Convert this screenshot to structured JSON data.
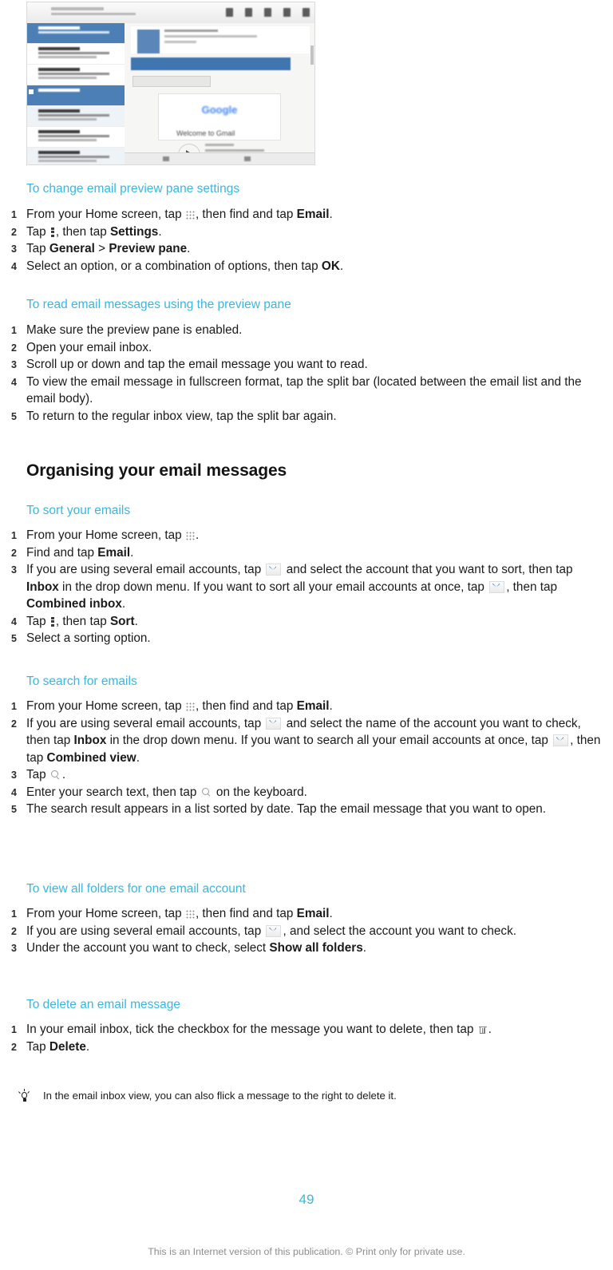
{
  "figure": {
    "caption": "Screenshot of tablet email application showing message list, preview pane and Welcome to Gmail message",
    "toolbar_icons": [
      "reply-icon",
      "refresh-icon",
      "search-icon",
      "delete-icon",
      "overflow-menu-icon"
    ],
    "welcome_title": "Welcome to Gmail",
    "brand": "Google"
  },
  "sections": [
    {
      "heading": "To change email preview pane settings",
      "steps": [
        {
          "num": "1",
          "parts": [
            {
              "type": "text",
              "text": "From your Home screen, tap "
            },
            {
              "type": "icon",
              "icon": "apps-grid-icon"
            },
            {
              "type": "text",
              "text": ", then find and tap "
            },
            {
              "type": "bold",
              "text": "Email"
            },
            {
              "type": "text",
              "text": "."
            }
          ]
        },
        {
          "num": "2",
          "parts": [
            {
              "type": "text",
              "text": "Tap "
            },
            {
              "type": "icon",
              "icon": "overflow-menu-icon"
            },
            {
              "type": "text",
              "text": ", then tap "
            },
            {
              "type": "bold",
              "text": "Settings"
            },
            {
              "type": "text",
              "text": "."
            }
          ]
        },
        {
          "num": "3",
          "parts": [
            {
              "type": "text",
              "text": "Tap "
            },
            {
              "type": "bold",
              "text": "General"
            },
            {
              "type": "text",
              "text": " > "
            },
            {
              "type": "bold",
              "text": "Preview pane"
            },
            {
              "type": "text",
              "text": "."
            }
          ]
        },
        {
          "num": "4",
          "parts": [
            {
              "type": "text",
              "text": "Select an option, or a combination of options, then tap "
            },
            {
              "type": "bold",
              "text": "OK"
            },
            {
              "type": "text",
              "text": "."
            }
          ]
        }
      ]
    },
    {
      "heading": "To read email messages using the preview pane",
      "steps": [
        {
          "num": "1",
          "parts": [
            {
              "type": "text",
              "text": "Make sure the preview pane is enabled."
            }
          ]
        },
        {
          "num": "2",
          "parts": [
            {
              "type": "text",
              "text": "Open your email inbox."
            }
          ]
        },
        {
          "num": "3",
          "parts": [
            {
              "type": "text",
              "text": "Scroll up or down and tap the email message you want to read."
            }
          ]
        },
        {
          "num": "4",
          "parts": [
            {
              "type": "text",
              "text": "To view the email message in fullscreen format, tap the split bar (located between the email list and the email body)."
            }
          ]
        },
        {
          "num": "5",
          "parts": [
            {
              "type": "text",
              "text": "To return to the regular inbox view, tap the split bar again."
            }
          ]
        }
      ]
    }
  ],
  "chapter_heading": "Organising your email messages",
  "sections2": [
    {
      "heading": "To sort your emails",
      "steps": [
        {
          "num": "1",
          "parts": [
            {
              "type": "text",
              "text": "From your Home screen, tap "
            },
            {
              "type": "icon",
              "icon": "apps-grid-icon"
            },
            {
              "type": "text",
              "text": "."
            }
          ]
        },
        {
          "num": "2",
          "parts": [
            {
              "type": "text",
              "text": "Find and tap "
            },
            {
              "type": "bold",
              "text": "Email"
            },
            {
              "type": "text",
              "text": "."
            }
          ]
        },
        {
          "num": "3",
          "parts": [
            {
              "type": "text",
              "text": "If you are using several email accounts, tap "
            },
            {
              "type": "icon",
              "icon": "chevron-down-icon"
            },
            {
              "type": "text",
              "text": " and select the account that you want to sort, then tap "
            },
            {
              "type": "bold",
              "text": "Inbox"
            },
            {
              "type": "text",
              "text": " in the drop down menu. If you want to sort all your email accounts at once, tap "
            },
            {
              "type": "icon",
              "icon": "chevron-down-icon"
            },
            {
              "type": "text",
              "text": ", then tap "
            },
            {
              "type": "bold",
              "text": "Combined inbox"
            },
            {
              "type": "text",
              "text": "."
            }
          ]
        },
        {
          "num": "4",
          "parts": [
            {
              "type": "text",
              "text": "Tap "
            },
            {
              "type": "icon",
              "icon": "overflow-menu-icon"
            },
            {
              "type": "text",
              "text": ", then tap "
            },
            {
              "type": "bold",
              "text": "Sort"
            },
            {
              "type": "text",
              "text": "."
            }
          ]
        },
        {
          "num": "5",
          "parts": [
            {
              "type": "text",
              "text": "Select a sorting option."
            }
          ]
        }
      ]
    },
    {
      "heading": "To search for emails",
      "steps": [
        {
          "num": "1",
          "parts": [
            {
              "type": "text",
              "text": "From your Home screen, tap "
            },
            {
              "type": "icon",
              "icon": "apps-grid-icon"
            },
            {
              "type": "text",
              "text": ", then find and tap "
            },
            {
              "type": "bold",
              "text": "Email"
            },
            {
              "type": "text",
              "text": "."
            }
          ]
        },
        {
          "num": "2",
          "parts": [
            {
              "type": "text",
              "text": "If you are using several email accounts, tap "
            },
            {
              "type": "icon",
              "icon": "chevron-down-icon"
            },
            {
              "type": "text",
              "text": " and select the name of the account you want to check, then tap "
            },
            {
              "type": "bold",
              "text": "Inbox"
            },
            {
              "type": "text",
              "text": " in the drop down menu. If you want to search all your email accounts at once, tap "
            },
            {
              "type": "icon",
              "icon": "chevron-down-icon"
            },
            {
              "type": "text",
              "text": ", then tap "
            },
            {
              "type": "bold",
              "text": "Combined view"
            },
            {
              "type": "text",
              "text": "."
            }
          ]
        },
        {
          "num": "3",
          "parts": [
            {
              "type": "text",
              "text": "Tap "
            },
            {
              "type": "icon",
              "icon": "search-icon"
            },
            {
              "type": "text",
              "text": "."
            }
          ]
        },
        {
          "num": "4",
          "parts": [
            {
              "type": "text",
              "text": "Enter your search text, then tap "
            },
            {
              "type": "icon",
              "icon": "search-icon"
            },
            {
              "type": "text",
              "text": " on the keyboard."
            }
          ]
        },
        {
          "num": "5",
          "parts": [
            {
              "type": "text",
              "text": "The search result appears in a list sorted by date. Tap the email message that you want to open."
            }
          ]
        }
      ]
    },
    {
      "heading": "To view all folders for one email account",
      "steps": [
        {
          "num": "1",
          "parts": [
            {
              "type": "text",
              "text": "From your Home screen, tap "
            },
            {
              "type": "icon",
              "icon": "apps-grid-icon"
            },
            {
              "type": "text",
              "text": ", then find and tap "
            },
            {
              "type": "bold",
              "text": "Email"
            },
            {
              "type": "text",
              "text": "."
            }
          ]
        },
        {
          "num": "2",
          "parts": [
            {
              "type": "text",
              "text": "If you are using several email accounts, tap "
            },
            {
              "type": "icon",
              "icon": "chevron-down-icon"
            },
            {
              "type": "text",
              "text": ", and select the account you want to check."
            }
          ]
        },
        {
          "num": "3",
          "parts": [
            {
              "type": "text",
              "text": "Under the account you want to check, select "
            },
            {
              "type": "bold",
              "text": "Show all folders"
            },
            {
              "type": "text",
              "text": "."
            }
          ]
        }
      ]
    },
    {
      "heading": "To delete an email message",
      "steps": [
        {
          "num": "1",
          "parts": [
            {
              "type": "text",
              "text": "In your email inbox, tick the checkbox for the message you want to delete, then tap "
            },
            {
              "type": "icon",
              "icon": "trash-icon"
            },
            {
              "type": "text",
              "text": "."
            }
          ]
        },
        {
          "num": "2",
          "parts": [
            {
              "type": "text",
              "text": "Tap "
            },
            {
              "type": "bold",
              "text": "Delete"
            },
            {
              "type": "text",
              "text": "."
            }
          ]
        }
      ]
    }
  ],
  "tip": {
    "icon": "lightbulb-icon",
    "text": "In the email inbox view, you can also flick a message to the right to delete it."
  },
  "footer": {
    "page_number": "49",
    "note": "This is an Internet version of this publication. © Print only for private use."
  },
  "colors": {
    "heading_accent": "#39b7e0",
    "body_text": "#1a1a1a",
    "footer_text": "#8d8d8d"
  }
}
